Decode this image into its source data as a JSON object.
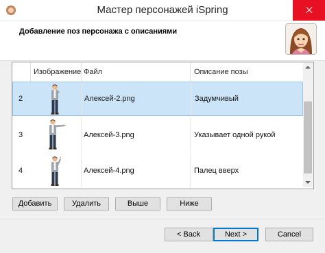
{
  "window": {
    "title": "Мастер персонажей iSpring"
  },
  "header": {
    "title": "Добавление поз персонажа с описаниями"
  },
  "table": {
    "columns": [
      "Изображение",
      "Файл",
      "Описание позы"
    ],
    "rows": [
      {
        "num": "2",
        "file": "Алексей-2.png",
        "description": "Задумчивый",
        "pose": "thinking",
        "selected": true
      },
      {
        "num": "3",
        "file": "Алексей-3.png",
        "description": "Указывает одной рукой",
        "pose": "pointing",
        "selected": false
      },
      {
        "num": "4",
        "file": "Алексей-4.png",
        "description": "Палец вверх",
        "pose": "finger-up",
        "selected": false
      }
    ]
  },
  "list_buttons": {
    "add": "Добавить",
    "remove": "Удалить",
    "up": "Выше",
    "down": "Ниже"
  },
  "footer": {
    "back": "< Back",
    "next": "Next >",
    "cancel": "Cancel"
  },
  "colors": {
    "selection": "#cce4f7",
    "selection_border": "#99c6ee",
    "close": "#e81123",
    "default_button": "#0078d7"
  }
}
